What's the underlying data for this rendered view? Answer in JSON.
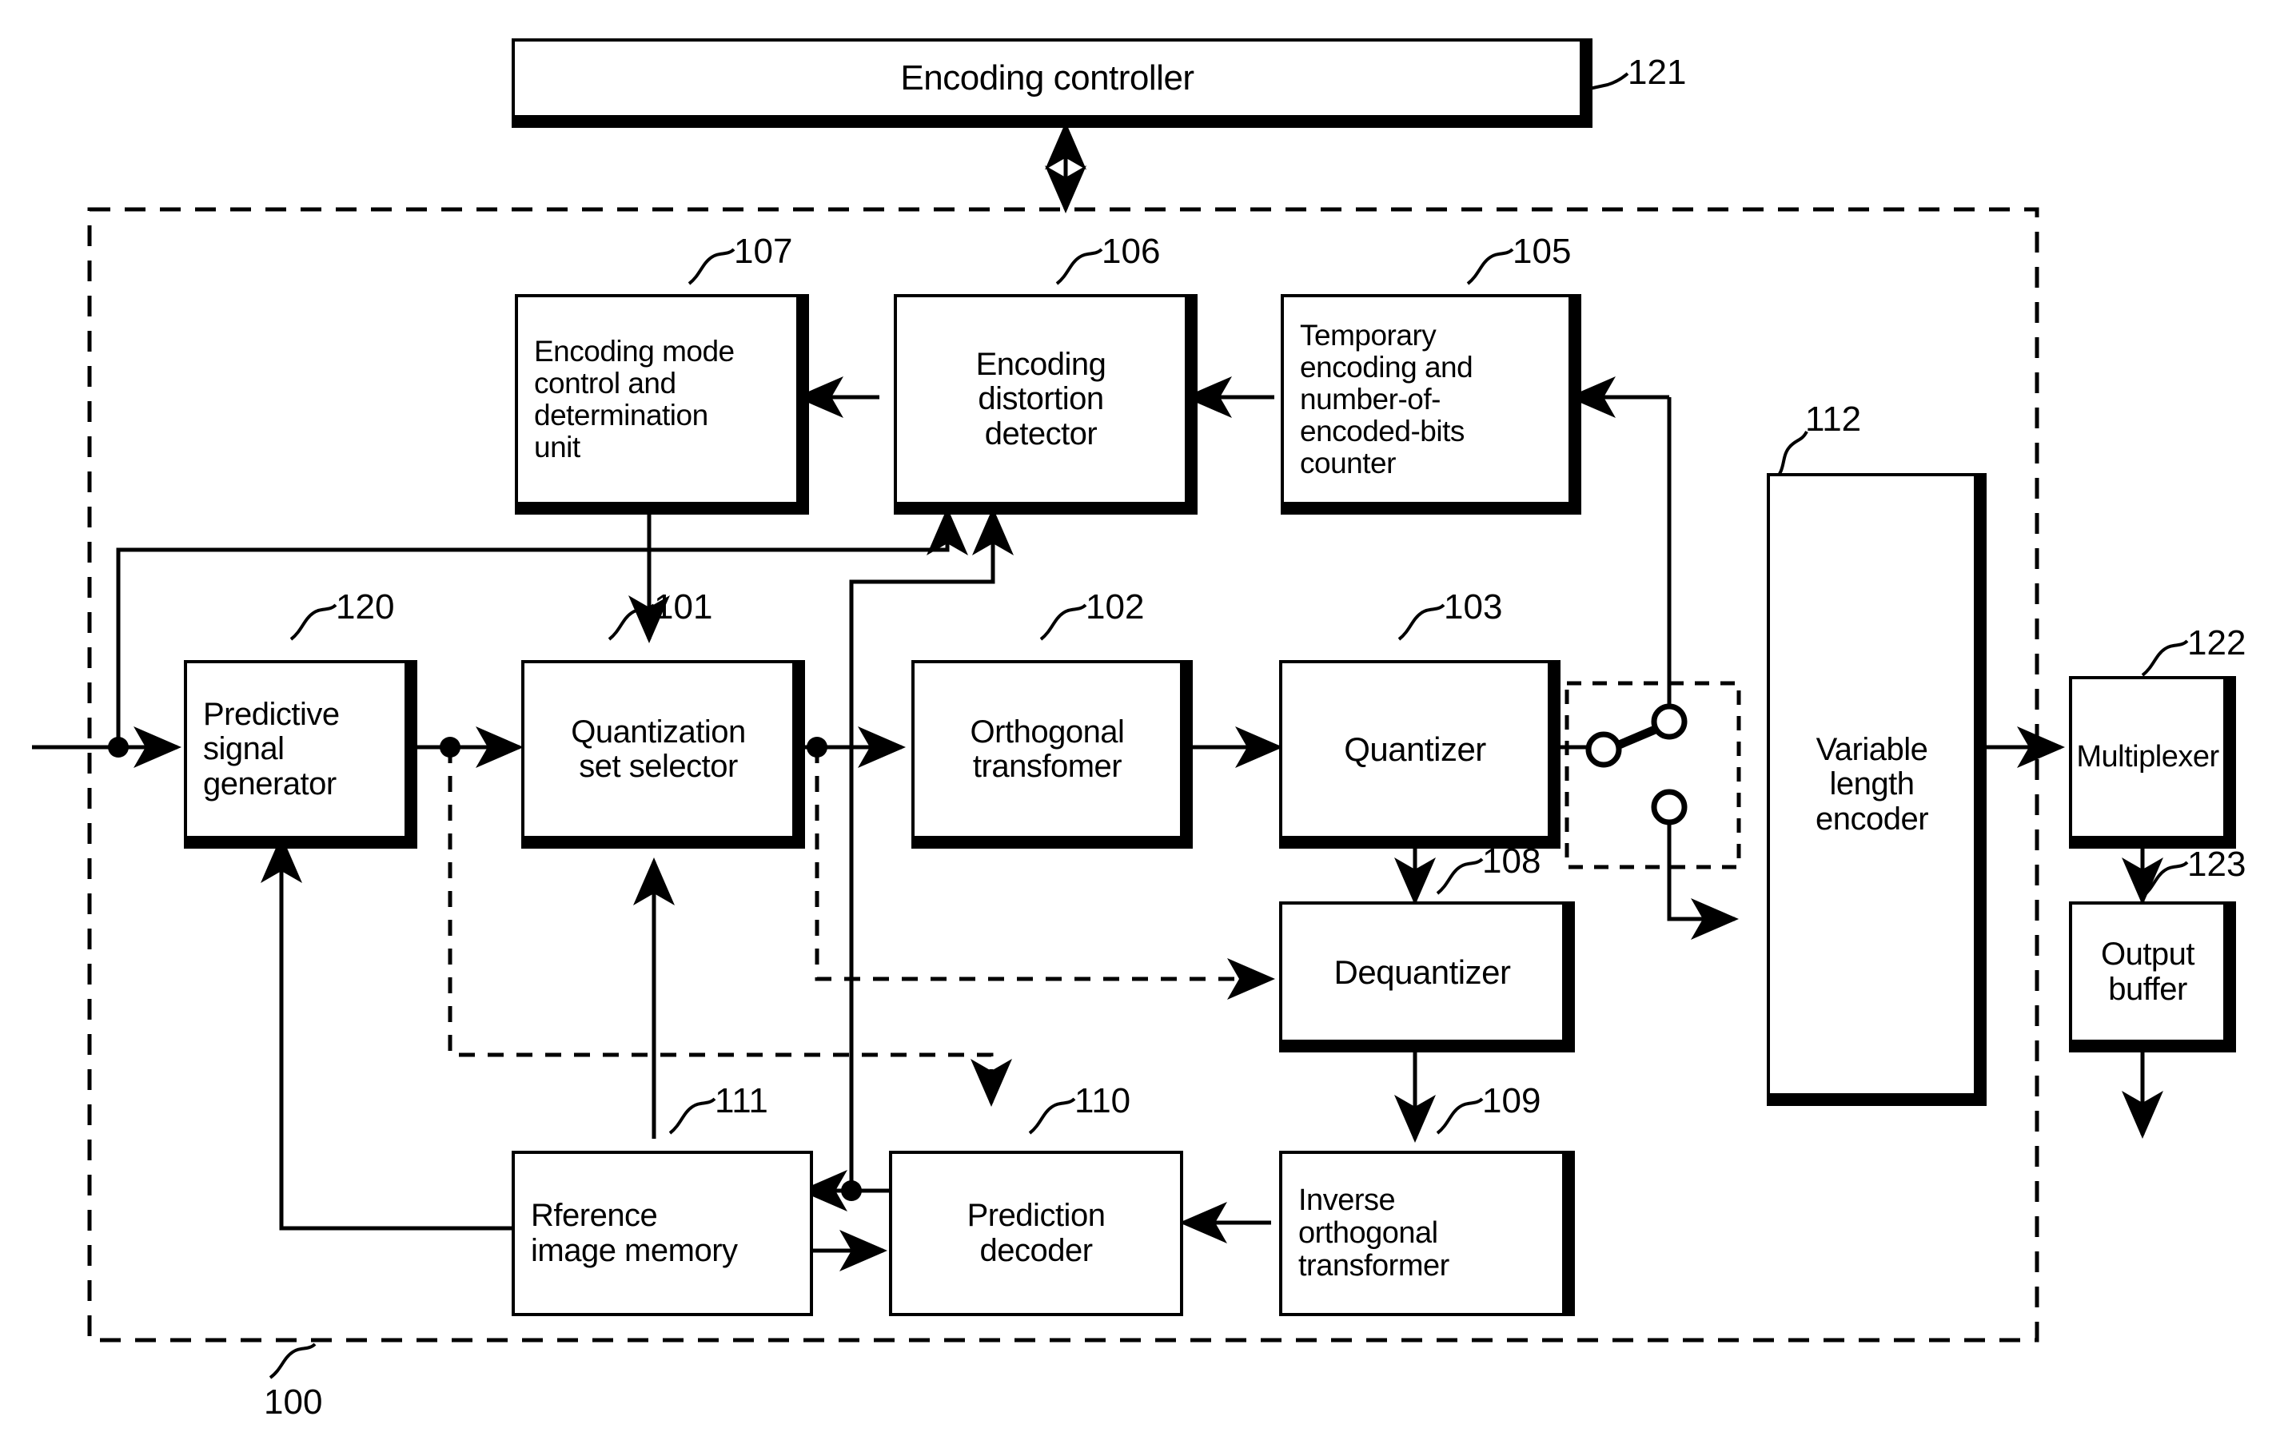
{
  "figure": {
    "type": "patent-block-diagram",
    "title": "Video encoding apparatus block diagram",
    "system_ref": "100"
  },
  "blocks": [
    {
      "id": "121",
      "label": "Encoding controller",
      "ref": "121"
    },
    {
      "id": "107",
      "label": "Encoding  mode\ncontrol  and\ndetermination\nunit",
      "ref": "107"
    },
    {
      "id": "106",
      "label": "Encoding\ndistortion\ndetector",
      "ref": "106"
    },
    {
      "id": "105",
      "label": "Temporary\nencoding and\nnumber-of-\nencoded-bits\ncounter",
      "ref": "105"
    },
    {
      "id": "112",
      "label": "Variable\nlength\nencoder",
      "ref": "112"
    },
    {
      "id": "120",
      "label": "Predictive\nsignal\ngenerator",
      "ref": "120"
    },
    {
      "id": "101",
      "label": "Quantization\nset  selector",
      "ref": "101"
    },
    {
      "id": "102",
      "label": "Orthogonal\ntransfomer",
      "ref": "102"
    },
    {
      "id": "103",
      "label": "Quantizer",
      "ref": "103"
    },
    {
      "id": "122",
      "label": "Multiplexer",
      "ref": "122"
    },
    {
      "id": "123",
      "label": "Output\nbuffer",
      "ref": "123"
    },
    {
      "id": "108",
      "label": "Dequantizer",
      "ref": "108"
    },
    {
      "id": "109",
      "label": "Inverse\northogonal\ntransformer",
      "ref": "109"
    },
    {
      "id": "111",
      "label": "Rference\nimage  memory",
      "ref": "111"
    },
    {
      "id": "110",
      "label": "Prediction\ndecoder",
      "ref": "110"
    }
  ],
  "refnums": {
    "r121": "121",
    "r107": "107",
    "r106": "106",
    "r105": "105",
    "r112": "112",
    "r120": "120",
    "r101": "101",
    "r102": "102",
    "r103": "103",
    "r122": "122",
    "r123": "123",
    "r108": "108",
    "r109": "109",
    "r111": "111",
    "r110": "110",
    "r100": "100"
  },
  "colors": {
    "stroke": "#000000",
    "background": "#ffffff"
  }
}
